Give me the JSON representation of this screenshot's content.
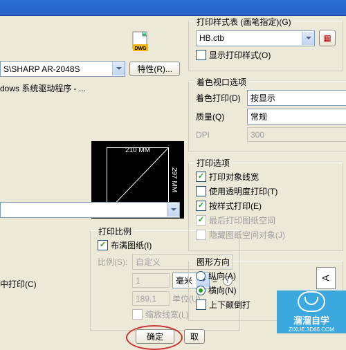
{
  "titlebar": "",
  "printer": {
    "name_value": "S\\SHARP AR-2048S",
    "properties_btn": "特性(R)...",
    "desc": "dows 系统驱动程序 - ..."
  },
  "preview": {
    "top": "210 MM",
    "side": "297 MM"
  },
  "styletable": {
    "title": "打印样式表 (画笔指定)(G)",
    "value": "HB.ctb",
    "show_styles": "显示打印样式(O)"
  },
  "shaded": {
    "title": "着色视口选项",
    "shade_label": "着色打印(D)",
    "shade_value": "按显示",
    "quality_label": "质量(Q)",
    "quality_value": "常规",
    "dpi_label": "DPI",
    "dpi_value": "300"
  },
  "options": {
    "title": "打印选项",
    "lineweights": "打印对象线宽",
    "transparency": "使用透明度打印(T)",
    "withstyles": "按样式打印(E)",
    "paperspace": "最后打印图纸空间",
    "hidepaperspace": "隐藏图纸空间对象(J)"
  },
  "scale": {
    "title": "打印比例",
    "fit": "布满图纸(I)",
    "scale_label": "比例(S):",
    "scale_value": "自定义",
    "unit_num": "1",
    "unit_type": "毫米",
    "eq": "=",
    "drawing_units": "189.1",
    "units_label": "单位(U)",
    "scale_lw": "缩放线宽(L)"
  },
  "center": "中打印(C)",
  "orient": {
    "title": "图形方向",
    "portrait": "纵向(A)",
    "landscape": "横向(N)",
    "upside": "上下颠倒打",
    "icon": "A"
  },
  "buttons": {
    "ok": "确定",
    "cancel": "取"
  },
  "watermark": {
    "name": "溜溜自学",
    "url": "ZIXUE.3D66.COM"
  }
}
